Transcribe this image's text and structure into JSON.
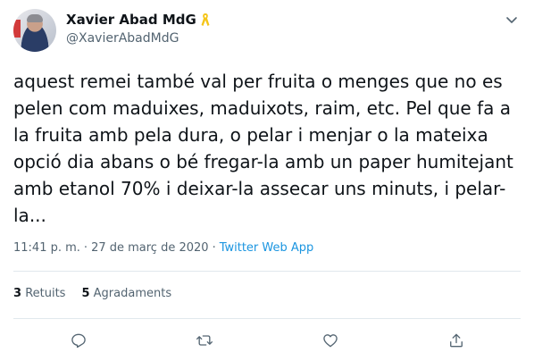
{
  "user": {
    "display_name": "Xavier Abad MdG",
    "handle": "@XavierAbadMdG"
  },
  "tweet": {
    "text": "aquest remei també val per fruita o menges que no es pelen com maduixes, maduixots, raim, etc. Pel que fa a la fruita amb pela dura, o pelar i menjar o la mateixa opció dia abans o bé fregar-la amb un paper humitejant amb etanol 70% i deixar-la assecar uns minuts, i pelar-la...",
    "time": "11:41 p. m.",
    "separator": "·",
    "date": "27 de març de 2020",
    "source": "Twitter Web App"
  },
  "stats": {
    "retweets_count": "3",
    "retweets_label": "Retuits",
    "likes_count": "5",
    "likes_label": "Agradaments"
  },
  "icons": {
    "badge": "yellow-ribbon-icon",
    "menu": "chevron-down-icon",
    "reply": "reply-icon",
    "retweet": "retweet-icon",
    "like": "heart-icon",
    "share": "share-icon"
  },
  "colors": {
    "text": "#0f1419",
    "secondary": "#536471",
    "link": "#1b95e0",
    "ribbon": "#f5c518",
    "divider": "#e1e8ed"
  }
}
